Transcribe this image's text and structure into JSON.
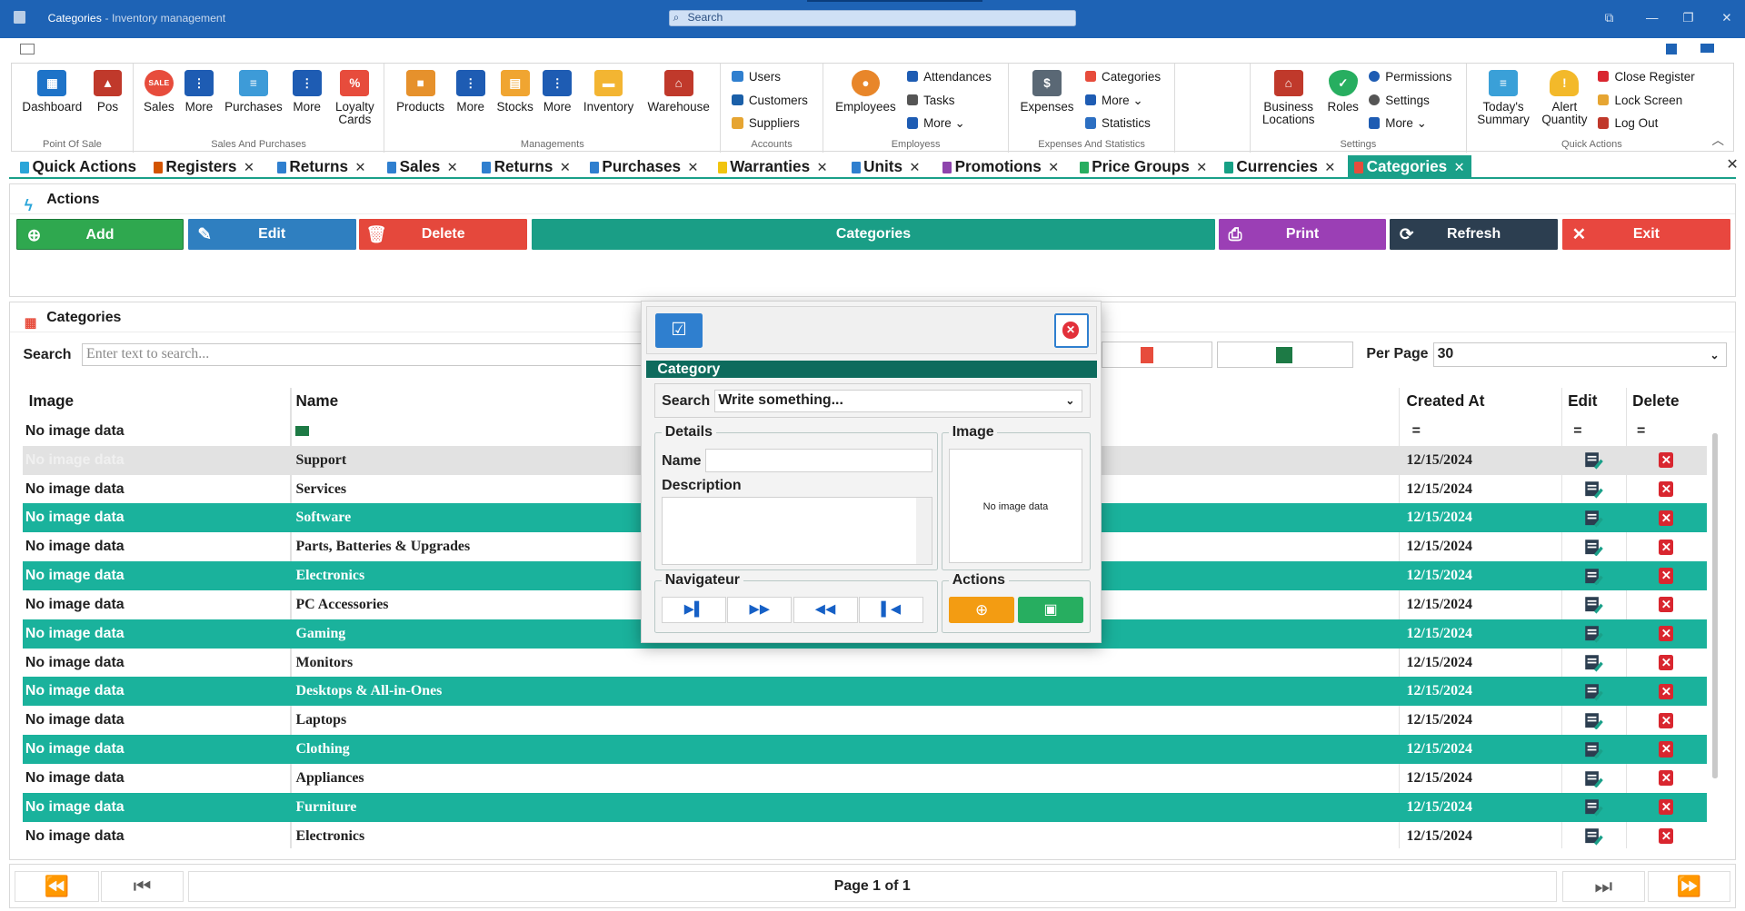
{
  "window": {
    "title": "Categories",
    "subtitle": "- Inventory management",
    "search_placeholder": "Search"
  },
  "ribbon": {
    "groups": [
      "Point Of Sale",
      "Sales And Purchases",
      "Managements",
      "Accounts",
      "Employess",
      "Expenses And Statistics",
      "Settings",
      "Quick Actions"
    ],
    "pos": [
      "Dashboard",
      "Pos"
    ],
    "sales": [
      "Sales",
      "More",
      "Purchases",
      "More",
      "Loyalty Cards"
    ],
    "mgmt": [
      "Products",
      "More",
      "Stocks",
      "More",
      "Inventory",
      "Warehouse"
    ],
    "accounts": [
      "Users",
      "Customers",
      "Suppliers"
    ],
    "employees_big": "Employees",
    "employees_small": [
      "Attendances",
      "Tasks",
      "More"
    ],
    "expenses_big": "Expenses",
    "expenses_small": [
      "Categories",
      "More",
      "Statistics"
    ],
    "settings_big": [
      "Business Locations",
      "Roles"
    ],
    "settings_small": [
      "Permissions",
      "Settings",
      "More"
    ],
    "quick_big": [
      "Today's Summary",
      "Alert Quantity"
    ],
    "quick_small": [
      "Close Register",
      "Lock Screen",
      "Log Out"
    ]
  },
  "tabs": [
    "Quick Actions",
    "Registers",
    "Returns",
    "Sales",
    "Returns",
    "Purchases",
    "Warranties",
    "Units",
    "Promotions",
    "Price Groups",
    "Currencies",
    "Categories"
  ],
  "actions": {
    "title": "Actions",
    "add": "Add",
    "edit": "Edit",
    "delete": "Delete",
    "center": "Categories",
    "print": "Print",
    "refresh": "Refresh",
    "exit": "Exit"
  },
  "categories_panel": {
    "title": "Categories",
    "search_label": "Search",
    "search_placeholder": "Enter text to search...",
    "per_page_label": "Per Page",
    "per_page_value": "30"
  },
  "grid": {
    "headers": [
      "Image",
      "Name",
      "Created At",
      "Edit",
      "Delete"
    ],
    "rows": [
      {
        "image": "No image data",
        "name": "Support",
        "date": "12/15/2024"
      },
      {
        "image": "No image data",
        "name": "Services",
        "date": "12/15/2024"
      },
      {
        "image": "No image data",
        "name": "Software",
        "date": "12/15/2024"
      },
      {
        "image": "No image data",
        "name": "Parts, Batteries & Upgrades",
        "date": "12/15/2024"
      },
      {
        "image": "No image data",
        "name": "Electronics",
        "date": "12/15/2024"
      },
      {
        "image": "No image data",
        "name": "PC Accessories",
        "date": "12/15/2024"
      },
      {
        "image": "No image data",
        "name": "Gaming",
        "date": "12/15/2024"
      },
      {
        "image": "No image data",
        "name": "Monitors",
        "date": "12/15/2024"
      },
      {
        "image": "No image data",
        "name": "Desktops & All-in-Ones",
        "date": "12/15/2024"
      },
      {
        "image": "No image data",
        "name": "Laptops",
        "date": "12/15/2024"
      },
      {
        "image": "No image data",
        "name": "Clothing",
        "date": "12/15/2024"
      },
      {
        "image": "No image data",
        "name": "Appliances",
        "date": "12/15/2024"
      },
      {
        "image": "No image data",
        "name": "Furniture",
        "date": "12/15/2024"
      },
      {
        "image": "No image data",
        "name": "Electronics",
        "date": "12/15/2024"
      }
    ],
    "filter_image": "No image data",
    "filter_symbol": "="
  },
  "pager": {
    "text": "Page 1 of 1"
  },
  "modal": {
    "title": "Category",
    "search_label": "Search",
    "search_value": "Write something...",
    "details": "Details",
    "name_label": "Name",
    "name_value": "",
    "description_label": "Description",
    "image_label": "Image",
    "no_image": "No image data",
    "navigator": "Navigateur",
    "actions": "Actions"
  },
  "colors": {
    "titlebar": "#1e63b5",
    "accent": "#1aa089",
    "add": "#2fa84f",
    "edit": "#2f7fc0",
    "delete": "#e5483c",
    "center": "#1a9e86",
    "print": "#9b3fb5",
    "refresh": "#2c3e50",
    "exit": "#e8473f"
  }
}
